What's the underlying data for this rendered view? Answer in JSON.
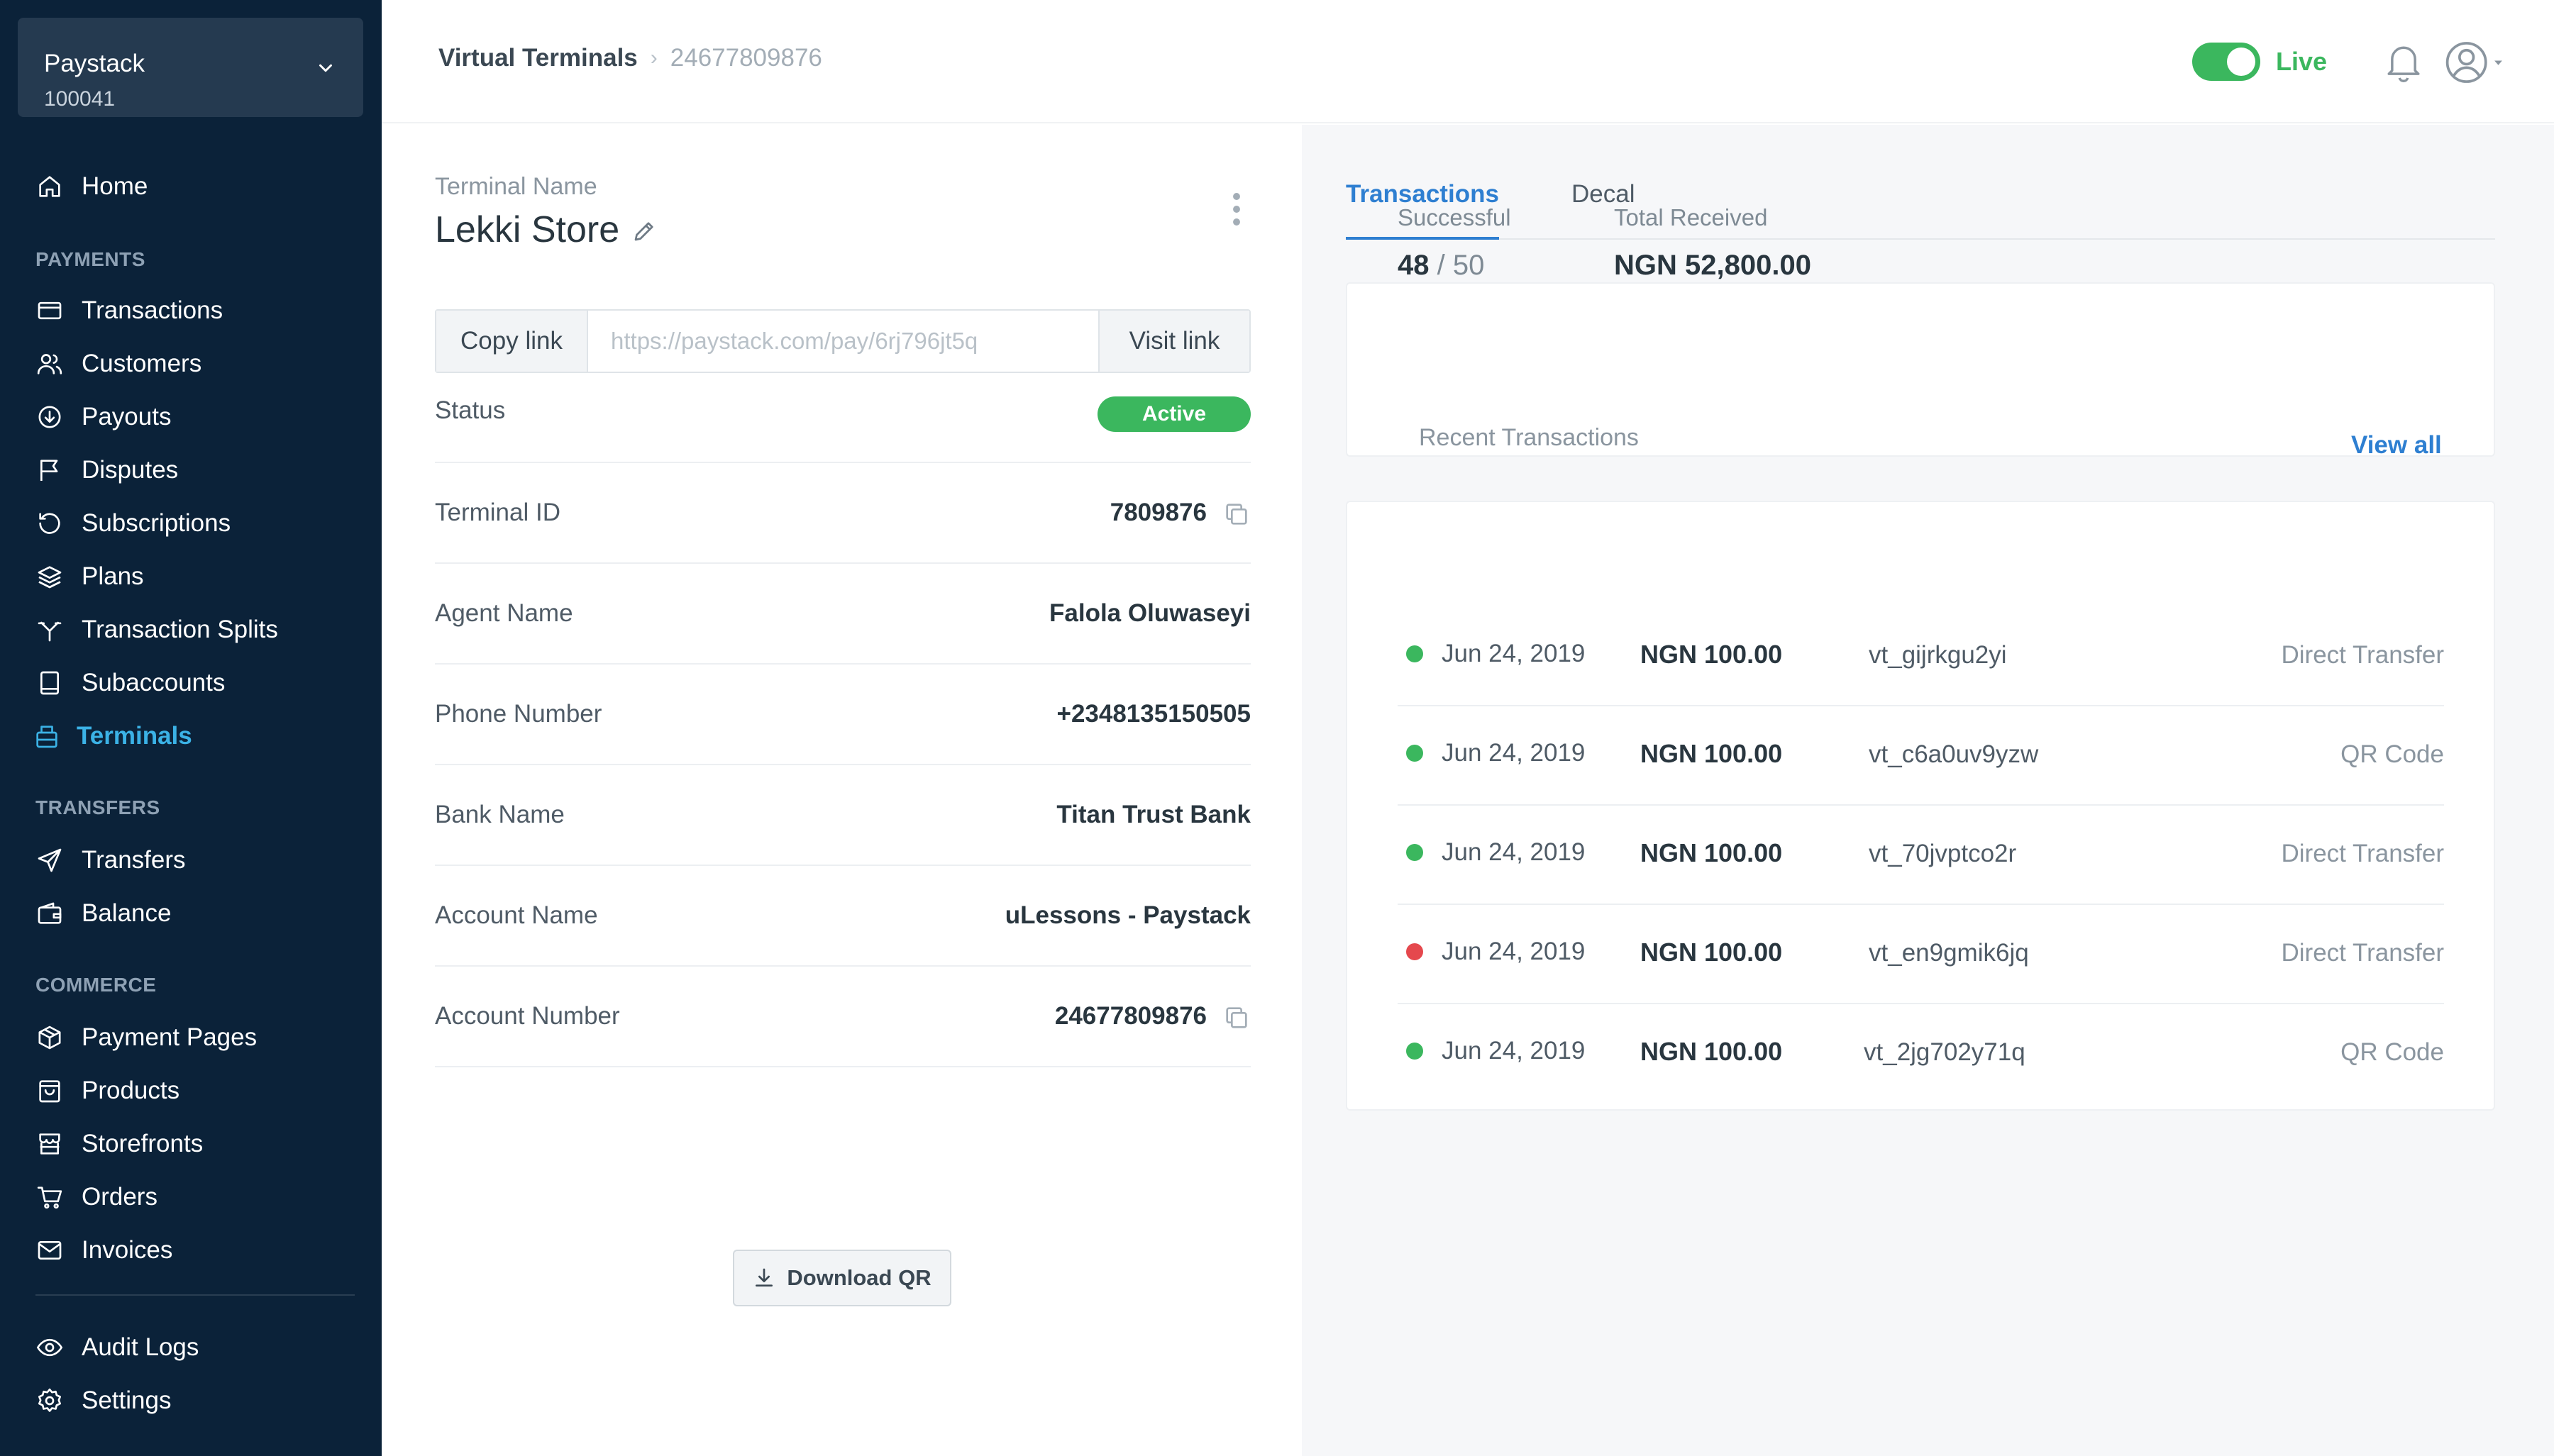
{
  "business": {
    "name": "Paystack",
    "id": "100041"
  },
  "sidebar": {
    "home": "Home",
    "sections": {
      "payments": "PAYMENTS",
      "transfers": "TRANSFERS",
      "commerce": "COMMERCE"
    },
    "payments": [
      "Transactions",
      "Customers",
      "Payouts",
      "Disputes",
      "Subscriptions",
      "Plans",
      "Transaction Splits",
      "Subaccounts",
      "Terminals"
    ],
    "transfers": [
      "Transfers",
      "Balance"
    ],
    "commerce": [
      "Payment Pages",
      "Products",
      "Storefronts",
      "Orders",
      "Invoices"
    ],
    "footer": [
      "Audit Logs",
      "Settings"
    ],
    "active_item": "Terminals",
    "active_color": "#3bb2e6"
  },
  "header": {
    "breadcrumb_parent": "Virtual Terminals",
    "breadcrumb_current": "24677809876",
    "mode_label": "Live",
    "mode_on": true,
    "accent_color": "#3bb75e"
  },
  "terminal": {
    "name_label": "Terminal Name",
    "name": "Lekki Store",
    "copy_link_label": "Copy link",
    "link_placeholder": "https://paystack.com/pay/6rj796jt5q",
    "visit_link_label": "Visit link",
    "status_label": "Status",
    "status_value": "Active",
    "fields": {
      "terminal_id": {
        "label": "Terminal ID",
        "value": "7809876"
      },
      "agent_name": {
        "label": "Agent Name",
        "value": "Falola Oluwaseyi"
      },
      "phone_number": {
        "label": "Phone Number",
        "value": "+2348135150505"
      },
      "bank_name": {
        "label": "Bank Name",
        "value": "Titan Trust Bank"
      },
      "account_name": {
        "label": "Account Name",
        "value": "uLessons - Paystack"
      },
      "account_number": {
        "label": "Account Number",
        "value": "24677809876"
      }
    },
    "download_qr_label": "Download QR"
  },
  "tabs": {
    "transactions": "Transactions",
    "decal": "Decal",
    "active": "Transactions"
  },
  "summary": {
    "successful_label": "Successful",
    "successful_count": "48",
    "separator": "/",
    "total_count": "50",
    "total_received_label": "Total Received",
    "total_received_value": "NGN 52,800.00"
  },
  "recent": {
    "title": "Recent Transactions",
    "view_all": "View all",
    "success_color": "#3bb75e",
    "failed_color": "#e5484d",
    "rows": [
      {
        "status": "success",
        "date": "Jun 24, 2019",
        "amount": "NGN 100.00",
        "reference": "vt_gijrkgu2yi",
        "channel": "Direct Transfer"
      },
      {
        "status": "success",
        "date": "Jun 24, 2019",
        "amount": "NGN 100.00",
        "reference": "vt_c6a0uv9yzw",
        "channel": "QR Code"
      },
      {
        "status": "success",
        "date": "Jun 24, 2019",
        "amount": "NGN 100.00",
        "reference": "vt_70jvptco2r",
        "channel": "Direct Transfer"
      },
      {
        "status": "failed",
        "date": "Jun 24, 2019",
        "amount": "NGN 100.00",
        "reference": "vt_en9gmik6jq",
        "channel": "Direct Transfer"
      },
      {
        "status": "success",
        "date": "Jun 24, 2019",
        "amount": "NGN 100.00",
        "reference": "vt_2jg702y71q",
        "channel": "QR Code"
      }
    ]
  }
}
